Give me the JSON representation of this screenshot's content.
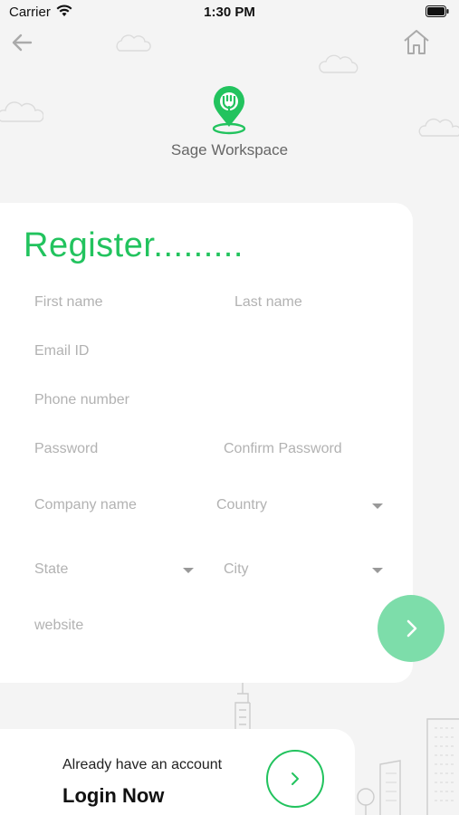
{
  "status_bar": {
    "carrier": "Carrier",
    "time": "1:30 PM"
  },
  "brand": {
    "name": "Sage Workspace",
    "accent": "#22c35e"
  },
  "form": {
    "title": "Register.........",
    "first_name_placeholder": "First name",
    "last_name_placeholder": "Last name",
    "email_placeholder": "Email ID",
    "phone_placeholder": "Phone number",
    "password_placeholder": "Password",
    "confirm_password_placeholder": "Confirm Password",
    "company_placeholder": "Company name",
    "country_placeholder": "Country",
    "state_placeholder": "State",
    "city_placeholder": "City",
    "website_placeholder": "website"
  },
  "footer": {
    "prompt": "Already have an account",
    "login_label": "Login Now"
  },
  "icons": [
    "back-arrow-icon",
    "home-icon",
    "location-pin-icon",
    "chevron-right-icon",
    "wifi-icon",
    "battery-icon"
  ]
}
